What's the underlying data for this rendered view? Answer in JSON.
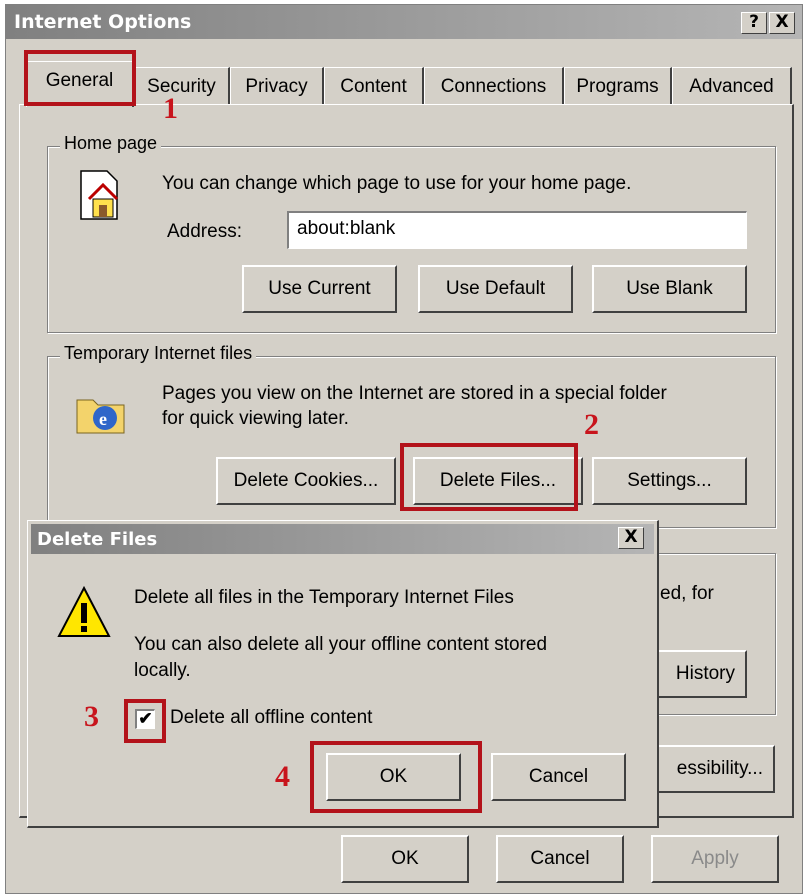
{
  "window": {
    "title": "Internet Options",
    "help": "?",
    "close": "X"
  },
  "tabs": [
    "General",
    "Security",
    "Privacy",
    "Content",
    "Connections",
    "Programs",
    "Advanced"
  ],
  "home": {
    "legend": "Home page",
    "desc": "You can change which page to use for your home page.",
    "address_label": "Address:",
    "address_value": "about:blank",
    "btn_current": "Use Current",
    "btn_default": "Use Default",
    "btn_blank": "Use Blank"
  },
  "temp": {
    "legend": "Temporary Internet files",
    "desc1": "Pages you view on the Internet are stored in a special folder",
    "desc2": "for quick viewing later.",
    "btn_cookies": "Delete Cookies...",
    "btn_files": "Delete Files...",
    "btn_settings": "Settings..."
  },
  "background": {
    "partial_text": "ed, for",
    "partial_history": "History",
    "partial_access": "essibility..."
  },
  "footer": {
    "ok": "OK",
    "cancel": "Cancel",
    "apply": "Apply"
  },
  "dialog": {
    "title": "Delete Files",
    "close": "X",
    "line1": "Delete all files in the Temporary Internet Files",
    "line2": "You can also delete all your offline content stored",
    "line3": "locally.",
    "checkbox_label": "Delete all offline content",
    "checkbox_mark": "✔",
    "ok": "OK",
    "cancel": "Cancel"
  },
  "annotations": {
    "n1": "1",
    "n2": "2",
    "n3": "3",
    "n4": "4"
  },
  "colors": {
    "highlight": "#b3121a",
    "number": "#c8141c",
    "face": "#d4d0c8"
  }
}
